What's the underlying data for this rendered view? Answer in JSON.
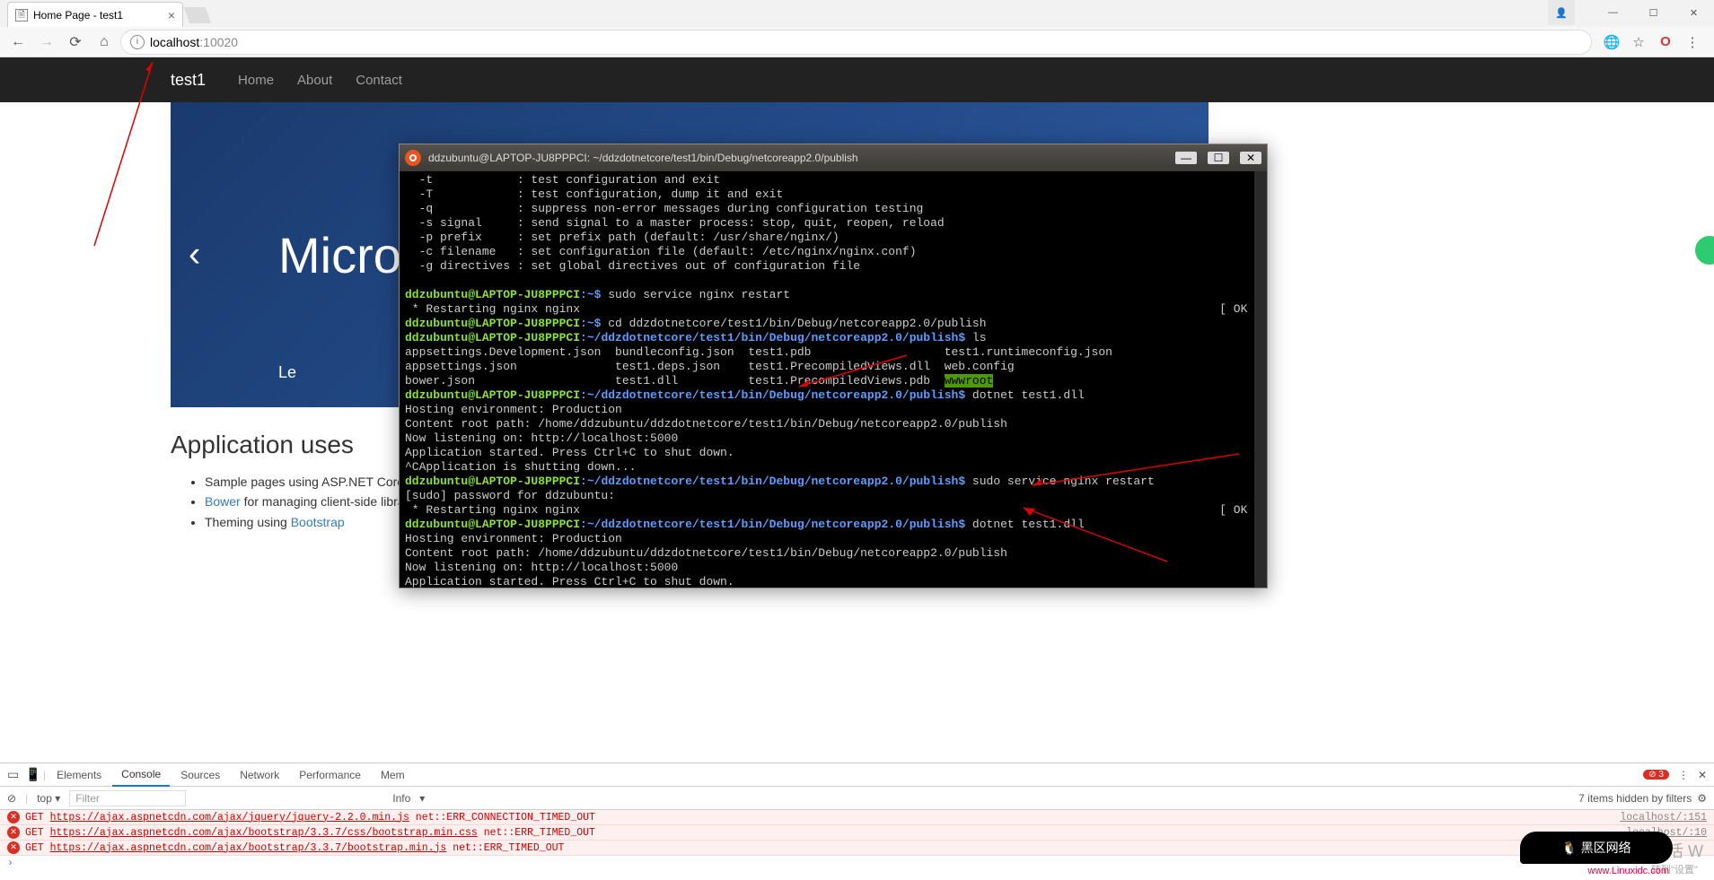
{
  "browser": {
    "tab_title": "Home Page - test1",
    "url_host": "localhost",
    "url_port": ":10020",
    "win_user": "👤"
  },
  "page": {
    "brand": "test1",
    "nav": [
      "Home",
      "About",
      "Contact"
    ],
    "hero_title": "Micro",
    "hero_learn_prefix": "Le",
    "uses_heading": "Application uses",
    "uses_items": [
      {
        "text": "Sample pages using ASP.NET Core MVC"
      },
      {
        "link": "Bower",
        "text": " for managing client-side libraries"
      },
      {
        "prefix": "Theming using ",
        "link": "Bootstrap"
      }
    ]
  },
  "terminal": {
    "title": "ddzubuntu@LAPTOP-JU8PPPCI: ~/ddzdotnetcore/test1/bin/Debug/netcoreapp2.0/publish",
    "lines": {
      "opt_t": "  -t            : test configuration and exit",
      "opt_T": "  -T            : test configuration, dump it and exit",
      "opt_q": "  -q            : suppress non-error messages during configuration testing",
      "opt_s": "  -s signal     : send signal to a master process: stop, quit, reopen, reload",
      "opt_p": "  -p prefix     : set prefix path (default: /usr/share/nginx/)",
      "opt_c": "  -c filename   : set configuration file (default: /etc/nginx/nginx.conf)",
      "opt_g": "  -g directives : set global directives out of configuration file",
      "prompt_home": "ddzubuntu@LAPTOP-JU8PPPCI",
      "tilde": ":~$",
      "cmd1": " sudo service nginx restart",
      "restart": " * Restarting nginx nginx",
      "ok": "[ OK ]",
      "cmd2": " cd ddzdotnetcore/test1/bin/Debug/netcoreapp2.0/publish",
      "path": ":~/ddzdotnetcore/test1/bin/Debug/netcoreapp2.0/publish$",
      "cmd_ls": " ls",
      "ls1": "appsettings.Development.json  bundleconfig.json  test1.pdb                   test1.runtimeconfig.json",
      "ls2": "appsettings.json              test1.deps.json    test1.PrecompiledViews.dll  web.config",
      "ls3_a": "bower.json                    test1.dll          test1.PrecompiledViews.pdb  ",
      "wwwroot": "wwwroot",
      "cmd_dotnet": " dotnet test1.dll",
      "host_env": "Hosting environment: Production",
      "content_root": "Content root path: /home/ddzubuntu/ddzdotnetcore/test1/bin/Debug/netcoreapp2.0/publish",
      "listening": "Now listening on: http://localhost:5000",
      "started": "Application started. Press Ctrl+C to shut down.",
      "shutting": "^CApplication is shutting down...",
      "sudo_pw": "[sudo] password for ddzubuntu:",
      "cmd_restart2": " sudo service nginx restart"
    }
  },
  "devtools": {
    "tabs": [
      "Elements",
      "Console",
      "Sources",
      "Network",
      "Performance",
      "Mem"
    ],
    "active_tab": "Console",
    "error_count": "3",
    "filter_top": "top",
    "filter_placeholder": "Filter",
    "info_label": "Info",
    "hidden_text": "7 items hidden by filters",
    "rows": [
      {
        "method": "GET",
        "url": "https://ajax.aspnetcdn.com/ajax/jquery/jquery-2.2.0.min.js",
        "err": "net::ERR_CONNECTION_TIMED_OUT",
        "src": "localhost/:151"
      },
      {
        "method": "GET",
        "url": "https://ajax.aspnetcdn.com/ajax/bootstrap/3.3.7/css/bootstrap.min.css",
        "err": "net::ERR_TIMED_OUT",
        "src": "localhost/:10"
      },
      {
        "method": "GET",
        "url": "https://ajax.aspnetcdn.com/ajax/bootstrap/3.3.7/bootstrap.min.js",
        "err": "net::ERR_TIMED_OUT",
        "src": ""
      }
    ]
  },
  "watermark": {
    "activate": "激活 W",
    "sub": "转到\"设置\"",
    "logo": "黑区网络",
    "logo_sub": "www.Linuxidc.com"
  }
}
